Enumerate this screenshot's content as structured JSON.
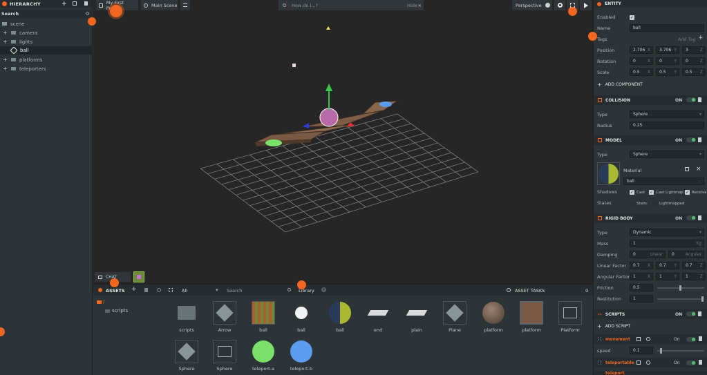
{
  "hierarchy": {
    "title": "HIERARCHY",
    "search_label": "Search",
    "items": [
      {
        "label": "scene"
      },
      {
        "label": "camera"
      },
      {
        "label": "lights"
      },
      {
        "label": "ball"
      },
      {
        "label": "platforms"
      },
      {
        "label": "teleporters"
      }
    ]
  },
  "toolbar": {
    "project": "My First Project",
    "scene": "Main Scene",
    "search_placeholder": "How do I...?",
    "hide": "Hide",
    "camera": "Perspective"
  },
  "chat": {
    "label": "CHAT"
  },
  "assets": {
    "title": "ASSETS",
    "filter": "All",
    "search": "Search",
    "library": "Library",
    "tasks": "ASSET TASKS",
    "tasks_count": "0",
    "root": "/",
    "folder": "scripts",
    "row1": [
      "scripts",
      "Arrow",
      "ball",
      "ball",
      "ball",
      "end",
      "plain",
      "Plane",
      "platform",
      "platform",
      "Platform"
    ],
    "row2": [
      "Sphere",
      "Sphere",
      "teleport-a",
      "teleport-b"
    ]
  },
  "inspector": {
    "entity_title": "ENTITY",
    "enabled_label": "Enabled",
    "name_label": "Name",
    "name_value": "ball",
    "tags_label": "Tags",
    "tags_placeholder": "Add Tag",
    "position_label": "Position",
    "position": [
      "2.706",
      "3.706",
      "3"
    ],
    "rotation_label": "Rotation",
    "rotation": [
      "0",
      "0",
      "0"
    ],
    "scale_label": "Scale",
    "scale": [
      "0.5",
      "0.5",
      "0.5"
    ],
    "axes": [
      "X",
      "Y",
      "Z"
    ],
    "add_component": "ADD COMPONENT",
    "on": "ON",
    "collision_title": "COLLISION",
    "type_label": "Type",
    "collision_type": "Sphere",
    "radius_label": "Radius",
    "radius_value": "0.25",
    "model_title": "MODEL",
    "model_type": "Sphere",
    "material_label": "Material",
    "material_value": "ball",
    "material_more": "...",
    "shadows_label": "Shadows",
    "cast": "Cast",
    "cast_lightmap": "Cast Lightmap",
    "receive": "Receive",
    "states_label": "States",
    "static": "Static",
    "lightmapped": "Lightmapped",
    "rigid_title": "RIGID BODY",
    "rigid_type": "Dynamic",
    "mass_label": "Mass",
    "mass_value": "1",
    "mass_unit": "Kg",
    "damping_label": "Damping",
    "damping": [
      "0",
      "0"
    ],
    "damping_linear": "Linear",
    "damping_angular": "Angular",
    "linear_factor_label": "Linear Factor",
    "linear_factor": [
      "0.7",
      "0.7",
      "0.7"
    ],
    "angular_factor_label": "Angular Factor",
    "angular_factor": [
      "1",
      "1",
      "1"
    ],
    "friction_label": "Friction",
    "friction_value": "0.5",
    "restitution_label": "Restitution",
    "restitution_value": "1",
    "scripts_title": "SCRIPTS",
    "add_script": "ADD SCRIPT",
    "script1": "movement",
    "script_on": "On",
    "speed_label": "speed",
    "speed_value": "0.1",
    "script2": "teleportable",
    "script3": "teleport"
  },
  "colors": {
    "accent": "#f2661f",
    "toggle_on": "#4fc06a",
    "ground_green": "#7be06a",
    "ground_blue": "#5a9cf0"
  }
}
